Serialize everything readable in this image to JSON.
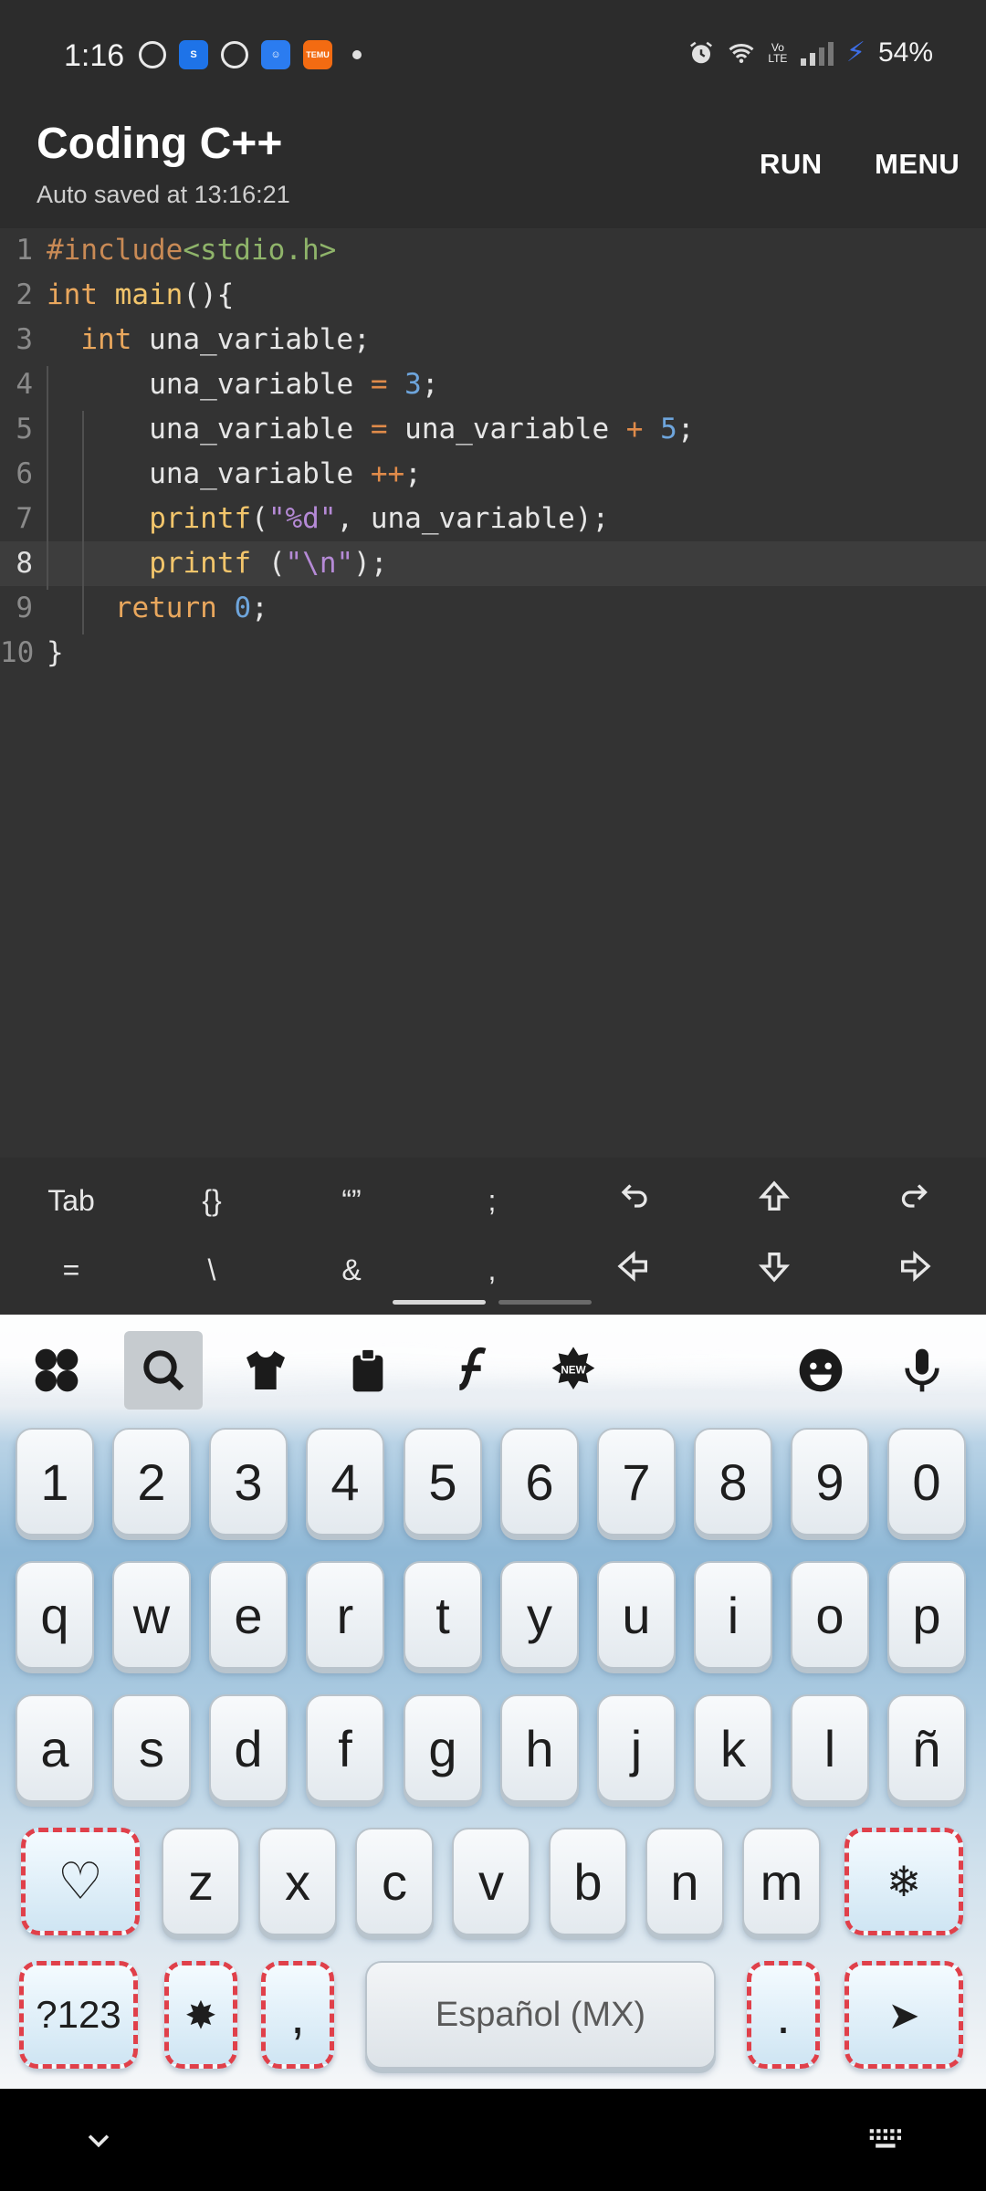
{
  "status_bar": {
    "time": "1:16",
    "battery": "54%",
    "notification_icons": [
      "whatsapp-icon",
      "shazam-icon",
      "whatsapp-icon",
      "messenger-icon",
      "temu-icon"
    ],
    "temu_label": "TEMU",
    "system_icons": [
      "alarm-icon",
      "wifi-icon",
      "volte-icon",
      "signal-icon",
      "charging-icon"
    ],
    "volte_label": "Vo LTE"
  },
  "app_header": {
    "title": "Coding C++",
    "subtitle": "Auto saved at 13:16:21",
    "run_label": "RUN",
    "menu_label": "MENU"
  },
  "editor": {
    "active_line": 8,
    "lines": [
      {
        "n": "1",
        "indent": 0,
        "tokens": [
          {
            "t": "#include",
            "c": "pp"
          },
          {
            "t": "<stdio.h>",
            "c": "inc"
          }
        ]
      },
      {
        "n": "2",
        "indent": 0,
        "tokens": [
          {
            "t": "int",
            "c": "kw"
          },
          {
            "t": " ",
            "c": ""
          },
          {
            "t": "main",
            "c": "fn"
          },
          {
            "t": "(){",
            "c": ""
          }
        ]
      },
      {
        "n": "3",
        "indent": 1,
        "tokens": [
          {
            "t": "int",
            "c": "kw"
          },
          {
            "t": " una_variable;",
            "c": ""
          }
        ]
      },
      {
        "n": "4",
        "indent": 3,
        "tokens": [
          {
            "t": "una_variable ",
            "c": ""
          },
          {
            "t": "=",
            "c": "op"
          },
          {
            "t": " ",
            "c": ""
          },
          {
            "t": "3",
            "c": "num"
          },
          {
            "t": ";",
            "c": ""
          }
        ]
      },
      {
        "n": "5",
        "indent": 3,
        "tokens": [
          {
            "t": "una_variable ",
            "c": ""
          },
          {
            "t": "=",
            "c": "op"
          },
          {
            "t": " una_variable ",
            "c": ""
          },
          {
            "t": "+",
            "c": "op"
          },
          {
            "t": " ",
            "c": ""
          },
          {
            "t": "5",
            "c": "num"
          },
          {
            "t": ";",
            "c": ""
          }
        ]
      },
      {
        "n": "6",
        "indent": 3,
        "tokens": [
          {
            "t": "una_variable ",
            "c": ""
          },
          {
            "t": "++",
            "c": "op"
          },
          {
            "t": ";",
            "c": ""
          }
        ]
      },
      {
        "n": "7",
        "indent": 3,
        "tokens": [
          {
            "t": "printf",
            "c": "fn"
          },
          {
            "t": "(",
            "c": ""
          },
          {
            "t": "\"%d\"",
            "c": "str"
          },
          {
            "t": ", una_variable);",
            "c": ""
          }
        ]
      },
      {
        "n": "8",
        "indent": 3,
        "tokens": [
          {
            "t": "printf",
            "c": "fn"
          },
          {
            "t": " (",
            "c": ""
          },
          {
            "t": "\"\\n\"",
            "c": "str"
          },
          {
            "t": ");",
            "c": ""
          }
        ]
      },
      {
        "n": "9",
        "indent": 2,
        "tokens": [
          {
            "t": "return",
            "c": "kw"
          },
          {
            "t": " ",
            "c": ""
          },
          {
            "t": "0",
            "c": "num"
          },
          {
            "t": ";",
            "c": ""
          }
        ]
      },
      {
        "n": "10",
        "indent": 0,
        "tokens": [
          {
            "t": "}",
            "c": ""
          }
        ]
      }
    ]
  },
  "extra_keys": {
    "row1": [
      {
        "label": "Tab",
        "name": "tab-key"
      },
      {
        "label": "{}",
        "name": "braces-key"
      },
      {
        "label": "“”",
        "name": "quotes-key"
      },
      {
        "label": ";",
        "name": "semicolon-key"
      },
      {
        "icon": "undo-icon",
        "name": "undo-key"
      },
      {
        "icon": "arrow-up-icon",
        "name": "up-key"
      },
      {
        "icon": "redo-icon",
        "name": "redo-key"
      }
    ],
    "row2": [
      {
        "label": "=",
        "name": "equals-key"
      },
      {
        "label": "\\",
        "name": "backslash-key"
      },
      {
        "label": "&",
        "name": "ampersand-key"
      },
      {
        "label": ",",
        "name": "comma-key"
      },
      {
        "icon": "arrow-left-icon",
        "name": "left-key"
      },
      {
        "icon": "arrow-down-icon",
        "name": "down-key"
      },
      {
        "icon": "arrow-right-icon",
        "name": "right-key"
      }
    ]
  },
  "keyboard": {
    "toolbar": [
      "apps-icon",
      "search-icon",
      "theme-shirt-icon",
      "clipboard-icon",
      "font-icon",
      "new-badge-icon",
      "emoji-icon",
      "microphone-icon"
    ],
    "new_badge": "NEW",
    "numbers": [
      "1",
      "2",
      "3",
      "4",
      "5",
      "6",
      "7",
      "8",
      "9",
      "0"
    ],
    "row1": [
      "q",
      "w",
      "e",
      "r",
      "t",
      "y",
      "u",
      "i",
      "o",
      "p"
    ],
    "row2": [
      "a",
      "s",
      "d",
      "f",
      "g",
      "h",
      "j",
      "k",
      "l",
      "ñ"
    ],
    "row3": [
      "z",
      "x",
      "c",
      "v",
      "b",
      "n",
      "m"
    ],
    "heart_key": "♡",
    "shift_key_icon": "snowflake-icon",
    "shift_glyph": "❄",
    "symbols_key": "?123",
    "settings_glyph": "✸",
    "comma_key": ",",
    "space_label": "Español (MX)",
    "period_key": ".",
    "enter_glyph": "➤"
  },
  "navbar": {
    "icons": [
      "chevron-down-icon",
      "keyboard-switch-icon"
    ]
  },
  "colors": {
    "background": "#2f2f2f",
    "editor_bg": "#333333",
    "keyword": "#e9a75d",
    "string": "#b58ad6",
    "number": "#6ea5dc",
    "candy_border": "#e0404a"
  }
}
